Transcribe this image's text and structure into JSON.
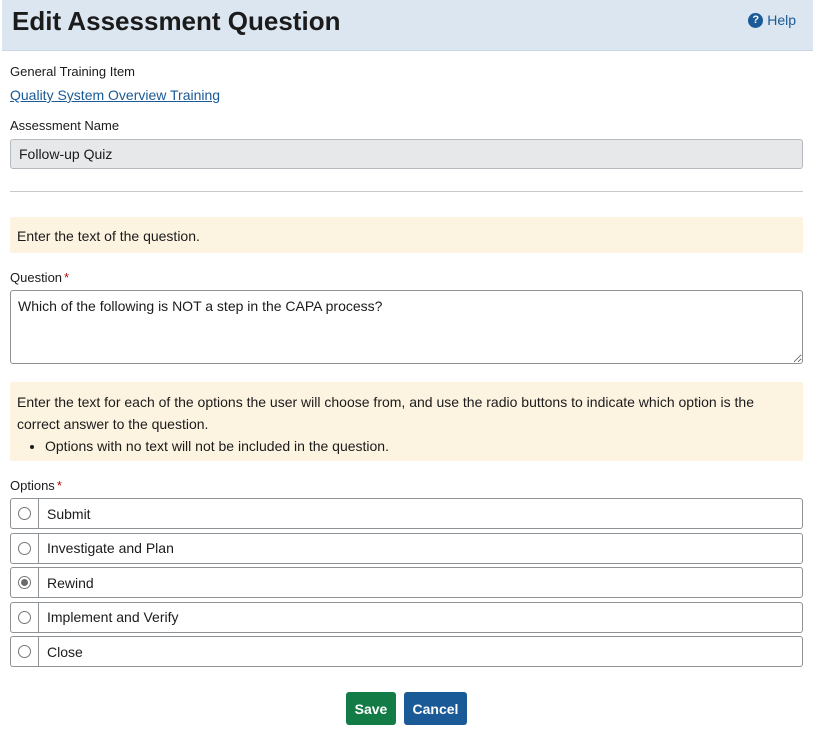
{
  "header": {
    "title": "Edit Assessment Question",
    "help_label": "Help"
  },
  "training": {
    "label": "General Training Item",
    "link": "Quality System Overview Training"
  },
  "assessment": {
    "label": "Assessment Name",
    "value": "Follow-up Quiz"
  },
  "instructions": {
    "question_text": "Enter the text of the question.",
    "options_text": "Enter the text for each of the options the user will choose from, and use the radio buttons to indicate which option is the correct answer to the question.",
    "options_bullet": "Options with no text will not be included in the question."
  },
  "question": {
    "label": "Question",
    "required_mark": "*",
    "value": "Which of the following is NOT a step in the CAPA process?"
  },
  "options": {
    "label": "Options",
    "required_mark": "*",
    "items": [
      {
        "text": "Submit",
        "selected": false
      },
      {
        "text": "Investigate and Plan",
        "selected": false
      },
      {
        "text": "Rewind",
        "selected": true
      },
      {
        "text": "Implement and Verify",
        "selected": false
      },
      {
        "text": "Close",
        "selected": false
      }
    ]
  },
  "actions": {
    "save_label": "Save",
    "cancel_label": "Cancel"
  },
  "colors": {
    "header_bg": "#dbe6f1",
    "link": "#1a5a96",
    "save": "#137b45",
    "cancel": "#1a5a96",
    "info_bg": "#fdf3e1",
    "required": "#b50909"
  }
}
